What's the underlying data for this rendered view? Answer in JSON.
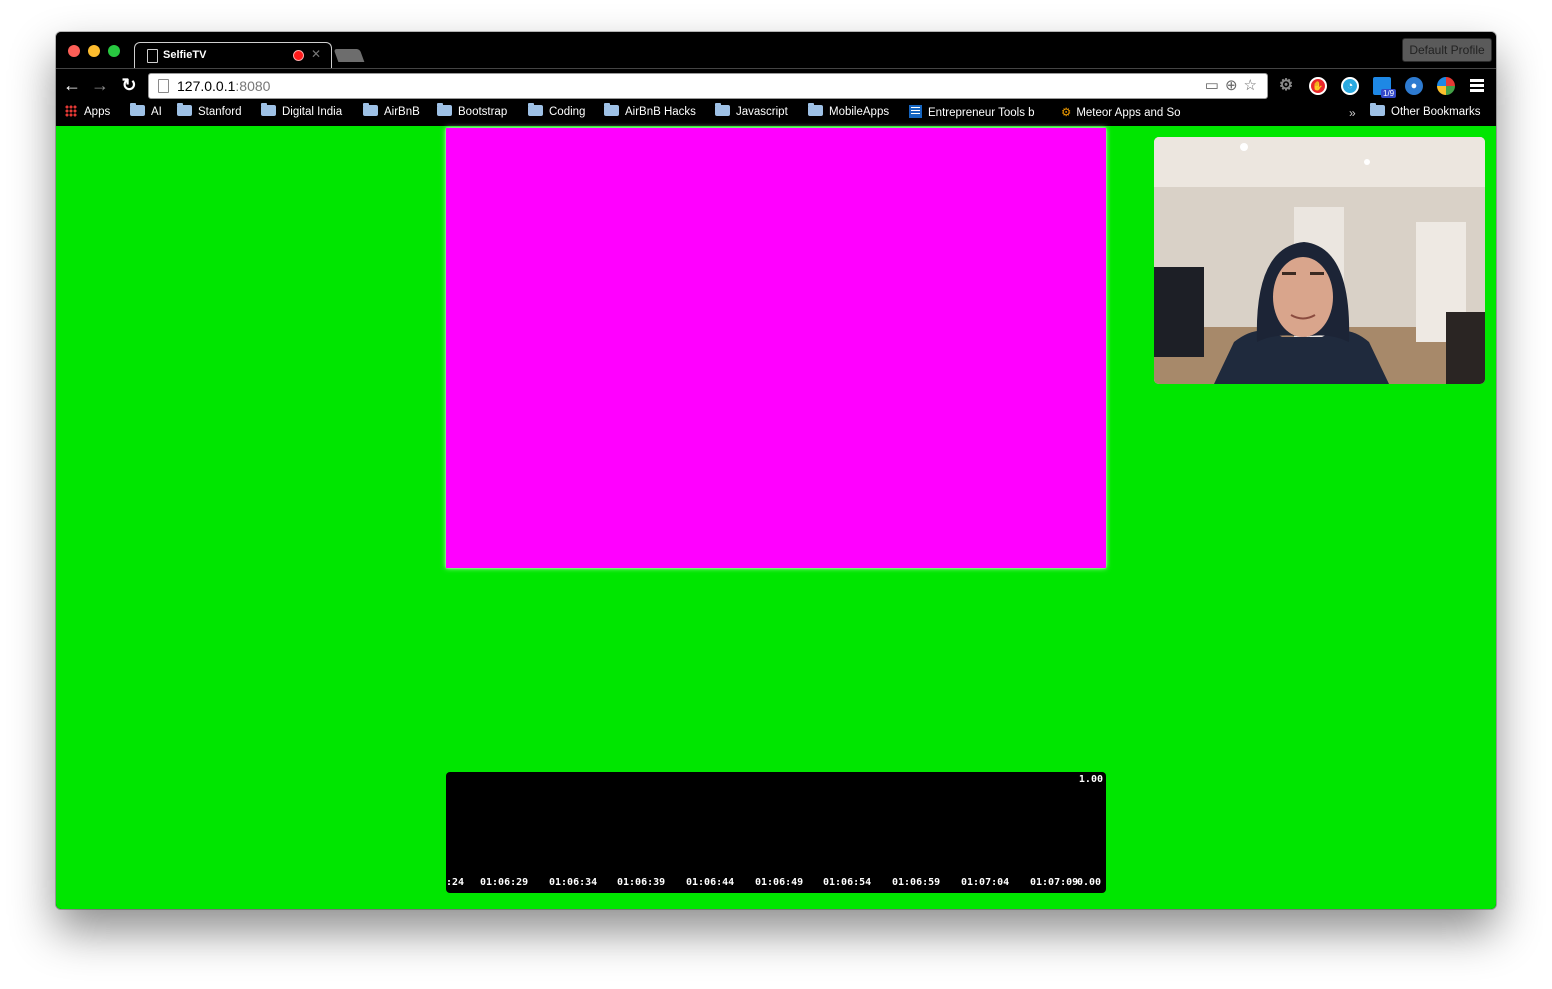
{
  "browser": {
    "profile_label": "Default Profile",
    "tab": {
      "title": "SelfieTV"
    },
    "url": {
      "host": "127.0.0.1",
      "port": ":8080"
    }
  },
  "bookmarks": {
    "apps_label": "Apps",
    "items": [
      "AI",
      "Stanford",
      "Digital India",
      "AirBnB",
      "Bootstrap",
      "Coding",
      "AirBnB Hacks",
      "Javascript",
      "MobileApps"
    ],
    "entrepreneur_label": "Entrepreneur Tools b",
    "meteor_label": "Meteor Apps and So",
    "overflow_label": "»",
    "other_label": "Other Bookmarks"
  },
  "extensions": {
    "calendar_badge": "1/9"
  },
  "page": {
    "background_color": "#00e600",
    "main_video_color": "#ff00ff",
    "webcam_subject": "person in dark hoodie in a white room"
  },
  "timeline": {
    "max_value_label": "1.00",
    "tick_labels": [
      ":24",
      "01:06:29",
      "01:06:34",
      "01:06:39",
      "01:06:44",
      "01:06:49",
      "01:06:54",
      "01:06:59",
      "01:07:04",
      "01:07:09"
    ],
    "end_value_label": "0.00"
  }
}
